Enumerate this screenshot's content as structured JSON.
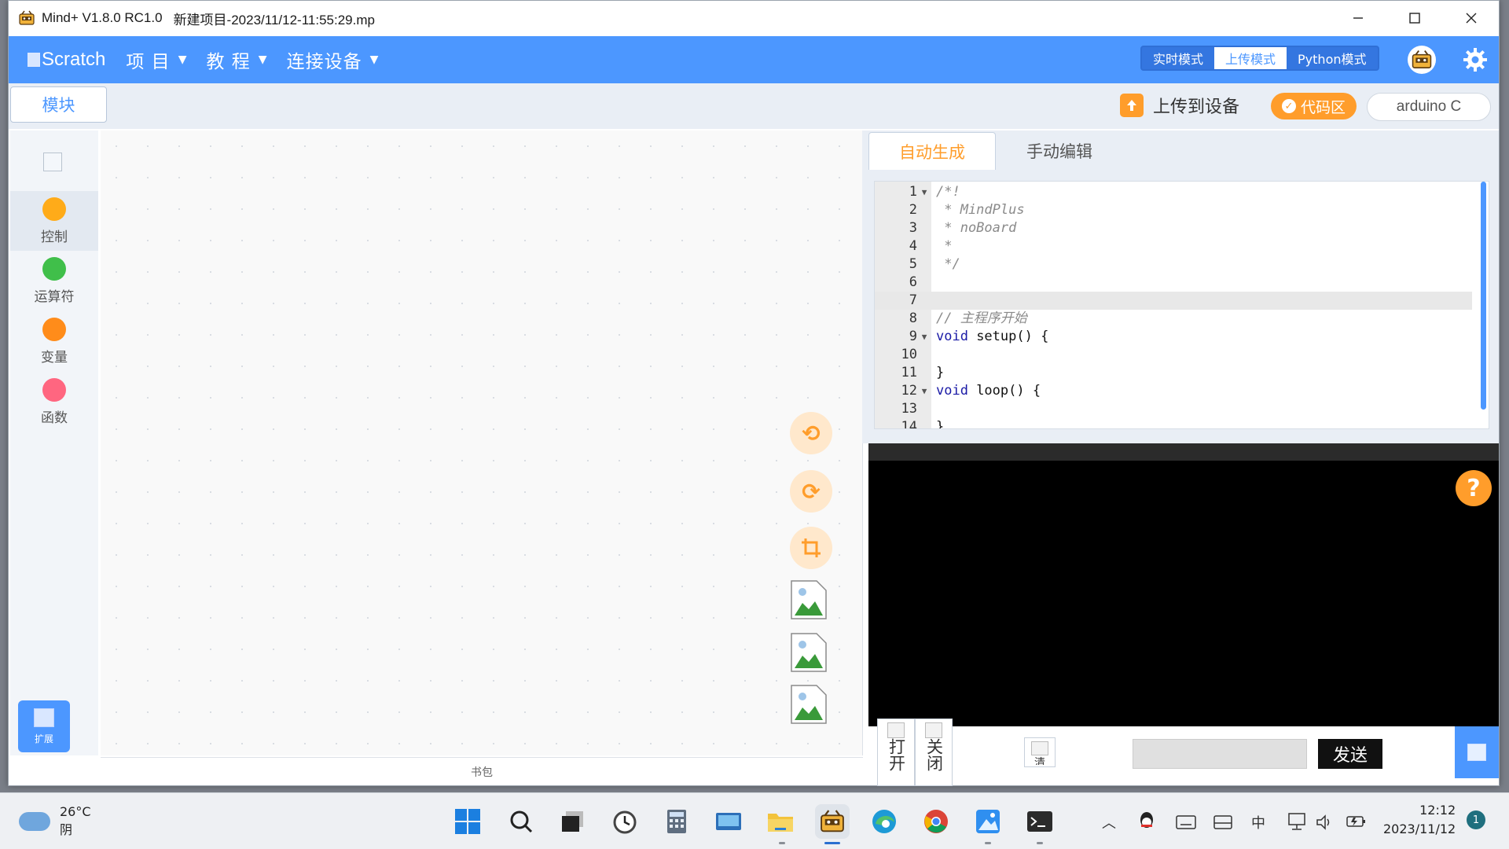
{
  "window": {
    "app_title": "Mind+ V1.8.0 RC1.0",
    "project_title": "新建项目-2023/11/12-11:55:29.mp"
  },
  "menubar": {
    "logo": "Scratch",
    "items": [
      {
        "label": "项 目"
      },
      {
        "label": "教 程"
      },
      {
        "label": "连接设备"
      }
    ],
    "modes": [
      {
        "label": "实时模式",
        "active": false
      },
      {
        "label": "上传模式",
        "active": true
      },
      {
        "label": "Python模式",
        "active": false
      }
    ],
    "accent": "#4c97ff"
  },
  "subbar": {
    "blocks_tab": "模块",
    "upload_label": "上传到设备",
    "code_area_label": "代码区",
    "board_label": "arduino C",
    "orange": "#ff9d2b"
  },
  "categories": [
    {
      "label": "控制",
      "color": "#ffab19",
      "selected": true
    },
    {
      "label": "运算符",
      "color": "#40bf4a",
      "selected": false
    },
    {
      "label": "变量",
      "color": "#ff8c1a",
      "selected": false
    },
    {
      "label": "函数",
      "color": "#ff6680",
      "selected": false
    }
  ],
  "extensions_label": "扩展",
  "backpack_label": "书包",
  "code_tabs": [
    {
      "label": "自动生成",
      "active": true
    },
    {
      "label": "手动编辑",
      "active": false
    }
  ],
  "code_lines": [
    {
      "n": "1",
      "fold": true,
      "text": "/*!",
      "kind": "comment"
    },
    {
      "n": "2",
      "fold": false,
      "text": " * MindPlus",
      "kind": "comment"
    },
    {
      "n": "3",
      "fold": false,
      "text": " * noBoard",
      "kind": "comment"
    },
    {
      "n": "4",
      "fold": false,
      "text": " *",
      "kind": "comment"
    },
    {
      "n": "5",
      "fold": false,
      "text": " */",
      "kind": "comment"
    },
    {
      "n": "6",
      "fold": false,
      "text": "",
      "kind": "plain"
    },
    {
      "n": "7",
      "fold": false,
      "text": "",
      "kind": "plain",
      "current": true
    },
    {
      "n": "8",
      "fold": false,
      "text": "// 主程序开始",
      "kind": "comment"
    },
    {
      "n": "9",
      "fold": true,
      "kw": "void",
      "text": " setup() {",
      "kind": "kw"
    },
    {
      "n": "10",
      "fold": false,
      "text": "",
      "kind": "plain"
    },
    {
      "n": "11",
      "fold": false,
      "text": "}",
      "kind": "plain"
    },
    {
      "n": "12",
      "fold": true,
      "kw": "void",
      "text": " loop() {",
      "kind": "kw"
    },
    {
      "n": "13",
      "fold": false,
      "text": "",
      "kind": "plain"
    },
    {
      "n": "14",
      "fold": false,
      "text": "}",
      "kind": "plain"
    }
  ],
  "serial": {
    "open_label": "打开",
    "close_label": "关闭",
    "mid_label": "清",
    "send_label": "发送",
    "help": "?"
  },
  "taskbar": {
    "weather_temp": "26°C",
    "weather_cond": "阴",
    "ime": "中",
    "time": "12:12",
    "date": "2023/11/12",
    "notification_count": "1"
  }
}
